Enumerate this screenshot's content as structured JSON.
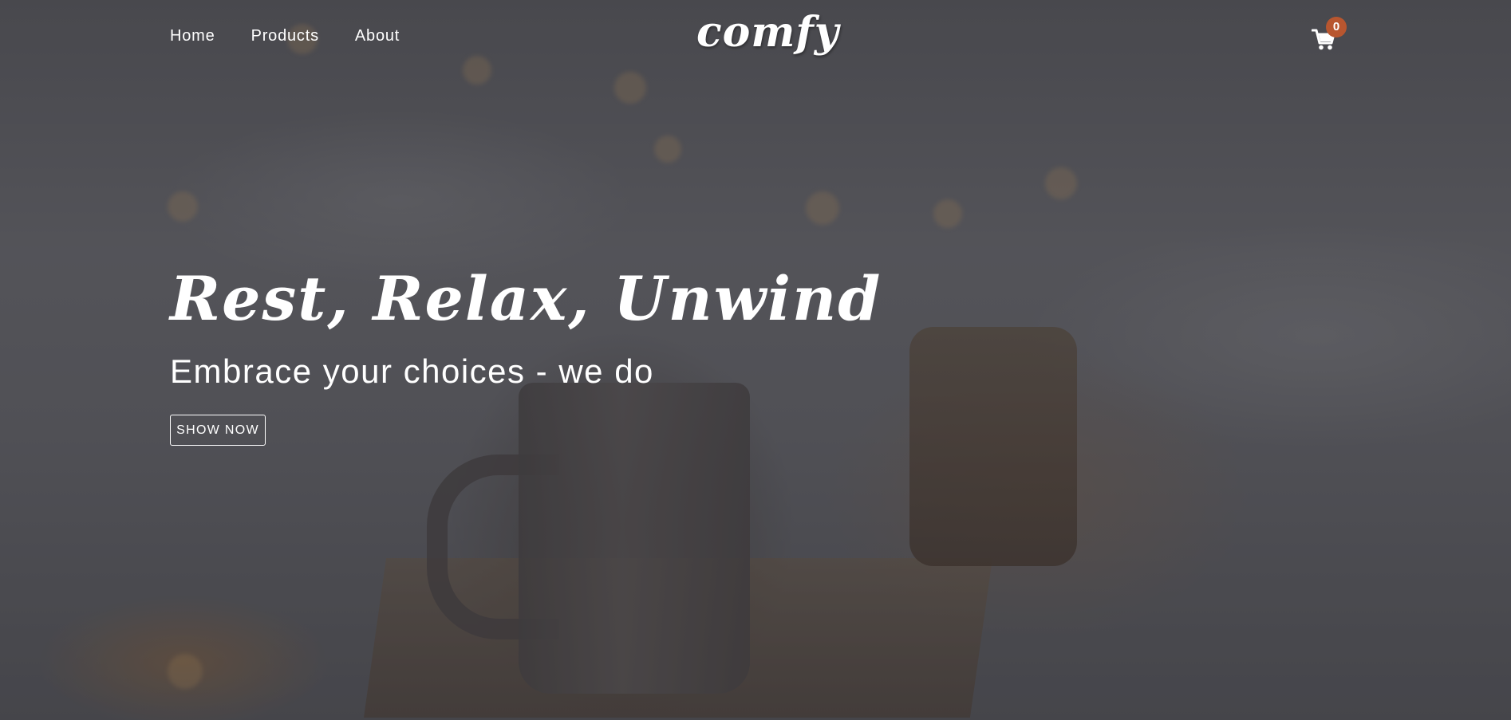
{
  "nav": {
    "links": [
      {
        "label": "Home"
      },
      {
        "label": "Products"
      },
      {
        "label": "About"
      }
    ],
    "logo": "comfy",
    "cart": {
      "icon": "cart-icon",
      "count": "0",
      "badge_color": "#b8562f"
    }
  },
  "hero": {
    "title": "Rest, Relax, Unwind",
    "subtitle": "Embrace your choices - we do",
    "button_label": "SHOW NOW"
  }
}
